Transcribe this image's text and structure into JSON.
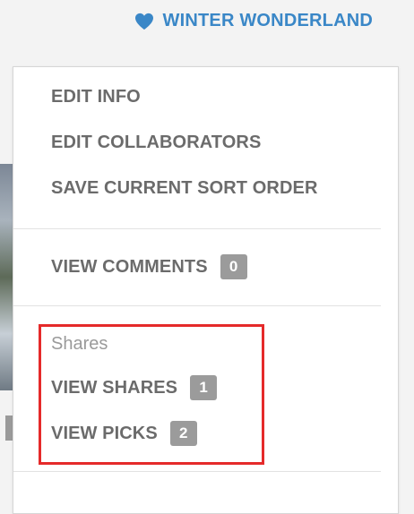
{
  "header": {
    "collection_title": "WINTER WONDERLAND",
    "heart_icon": "heart-icon",
    "accent_color": "#3a87c7"
  },
  "menu": {
    "edit_info": "EDIT INFO",
    "edit_collaborators": "EDIT COLLABORATORS",
    "save_sort_order": "SAVE CURRENT SORT ORDER",
    "view_comments": "VIEW COMMENTS",
    "comments_count": "0",
    "shares_section_label": "Shares",
    "view_shares": "VIEW SHARES",
    "shares_count": "1",
    "view_picks": "VIEW PICKS",
    "picks_count": "2"
  },
  "colors": {
    "highlight": "#e52a2a",
    "badge": "#9b9b9b",
    "menu_text": "#6b6b6b"
  }
}
